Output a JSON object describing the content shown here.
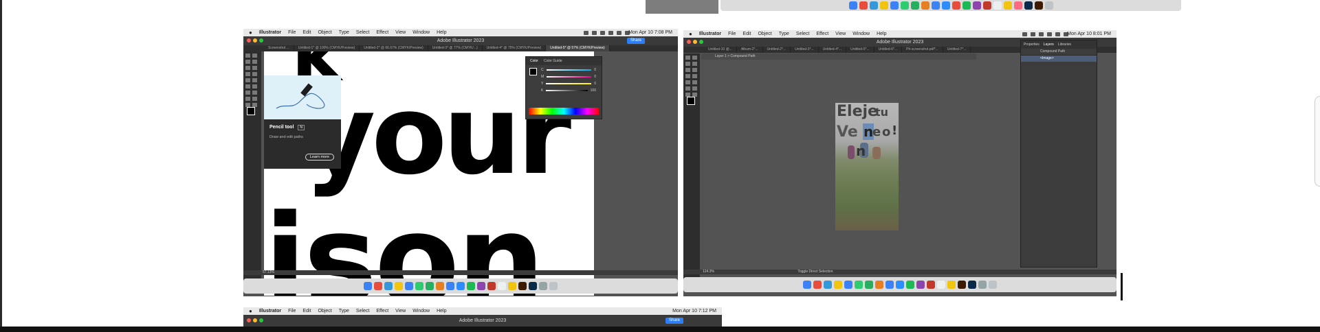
{
  "left_window": {
    "menubar": {
      "items": [
        "Illustrator",
        "File",
        "Edit",
        "Object",
        "Type",
        "Select",
        "Effect",
        "View",
        "Window",
        "Help"
      ],
      "clock": "Mon Apr 10  7:08 PM"
    },
    "title": "Adobe Illustrator 2023",
    "share_label": "Share",
    "tabs": [
      "Screenshot ...",
      "Untitled-1* @ 100% (CMYK/Preview)",
      "Untitled-2* @ 66.67% (CMYK/Preview)",
      "Untitled-3* @ 77% (CMYK/...)",
      "Untitled-4* @ 75% (CMYK/Preview)",
      "Untitled-5* @ 57% (CMYK/Preview)"
    ],
    "canvas_text": [
      "k",
      "your",
      "ison"
    ],
    "tooltip": {
      "title": "Pencil tool",
      "shortcut": "N",
      "description": "Draw and edit paths",
      "button": "Learn more"
    },
    "color_panel": {
      "tabs": [
        "Color",
        "Color Guide"
      ],
      "channels": [
        "C",
        "M",
        "Y",
        "K"
      ],
      "values": [
        "0",
        "0",
        "0",
        "100"
      ]
    },
    "status": "57.13%"
  },
  "right_window": {
    "menubar": {
      "items": [
        "Illustrator",
        "File",
        "Edit",
        "Object",
        "Type",
        "Select",
        "Effect",
        "View",
        "Window",
        "Help"
      ],
      "clock": "Mon Apr 10  8:01 PM"
    },
    "title": "Adobe Illustrator 2023",
    "tabs": [
      "Untitled-10 @...",
      "Album-2*...",
      "Untitled-2*...",
      "Untitled-3*...",
      "Untitled-4*...",
      "Untitled-5*...",
      "Untitled-6*...",
      "Ph-screenshot.pdf*...",
      "Untitled-7*..."
    ],
    "breadcrumb": "Layer 1 > Compound Path",
    "poster_text": {
      "line1a": "Eleje",
      "line1b": "tu",
      "line2a": "Ve",
      "line2b": "n",
      "line2c": "e",
      "line2d": "o",
      "line2e": "!",
      "line3": "n"
    },
    "layers_panel": {
      "tabs": [
        "Properties",
        "Layers",
        "Libraries"
      ],
      "rows": [
        "Compound Path",
        "<Image>"
      ]
    },
    "status": "124.3%",
    "status_tool": "Toggle Direct Selection"
  },
  "bottom_window": {
    "menubar": {
      "items": [
        "Illustrator",
        "File",
        "Edit",
        "Object",
        "Type",
        "Select",
        "Effect",
        "View",
        "Window",
        "Help"
      ],
      "clock": "Mon Apr 10  7:12 PM"
    },
    "title": "Adobe Illustrator 2023",
    "share_label": "Share"
  },
  "colors": {
    "accent": "#2d7ff9",
    "ui_dark": "#535353",
    "red_light": "#ff5f57",
    "yellow_light": "#febc2e",
    "green_light": "#28c840"
  }
}
